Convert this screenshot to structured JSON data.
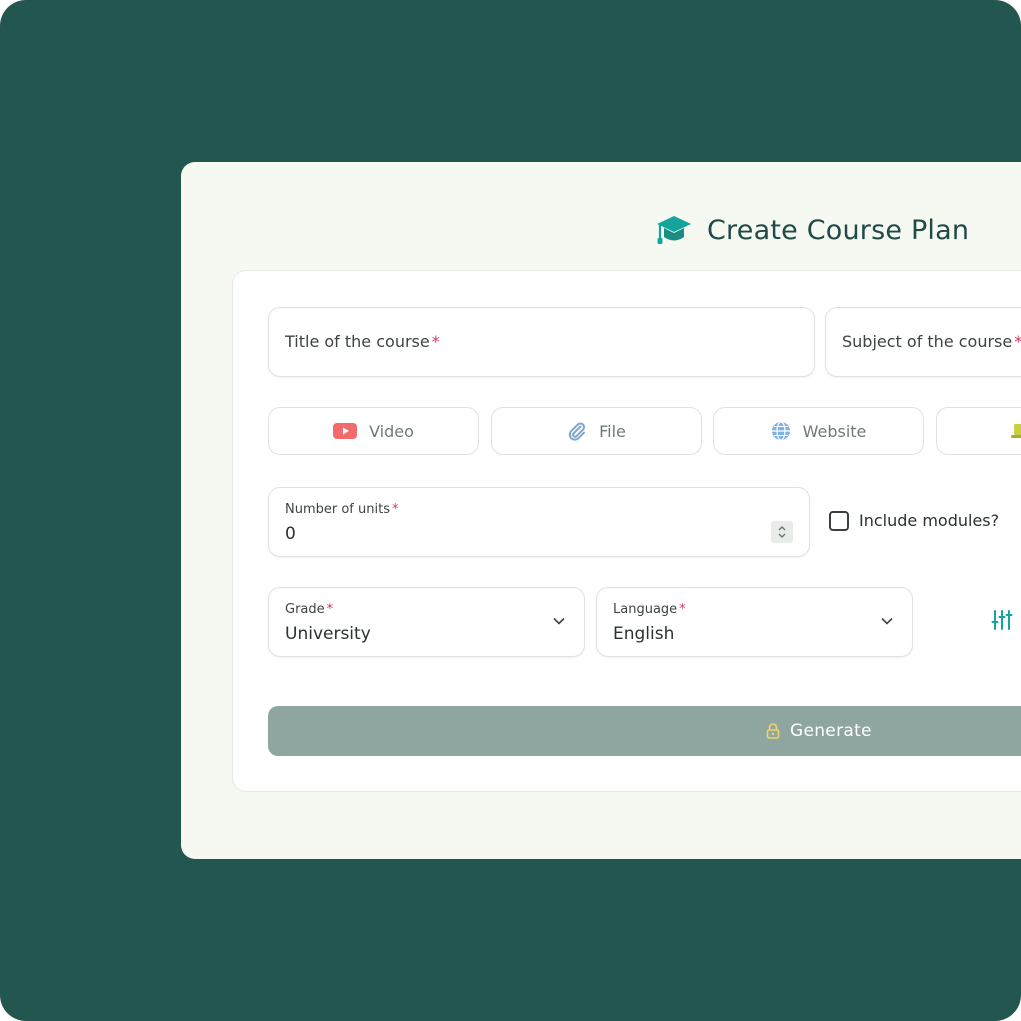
{
  "header": {
    "title": "Create Course Plan",
    "icon": "graduation-cap-icon",
    "accent_color": "#13a59b"
  },
  "form": {
    "title_field": {
      "placeholder": "Title of the course",
      "required_mark": "*"
    },
    "subject_field": {
      "placeholder": "Subject of the course",
      "required_mark": "*"
    },
    "sources": [
      {
        "label": "Video",
        "icon": "youtube-icon"
      },
      {
        "label": "File",
        "icon": "paperclip-icon"
      },
      {
        "label": "Website",
        "icon": "globe-icon"
      },
      {
        "label": "",
        "icon": "laptop-icon"
      }
    ],
    "units": {
      "label": "Number of units",
      "required_mark": "*",
      "value": "0"
    },
    "include_modules": {
      "label": "Include modules?",
      "checked": false
    },
    "grade": {
      "label": "Grade",
      "required_mark": "*",
      "value": "University"
    },
    "language": {
      "label": "Language",
      "required_mark": "*",
      "value": "English"
    },
    "generate": {
      "label": "Generate",
      "icon": "lock-icon"
    }
  },
  "colors": {
    "background": "#22564f",
    "panel": "#f6f8f2",
    "generate_button": "#8fa6a0",
    "required": "#d6345a"
  }
}
